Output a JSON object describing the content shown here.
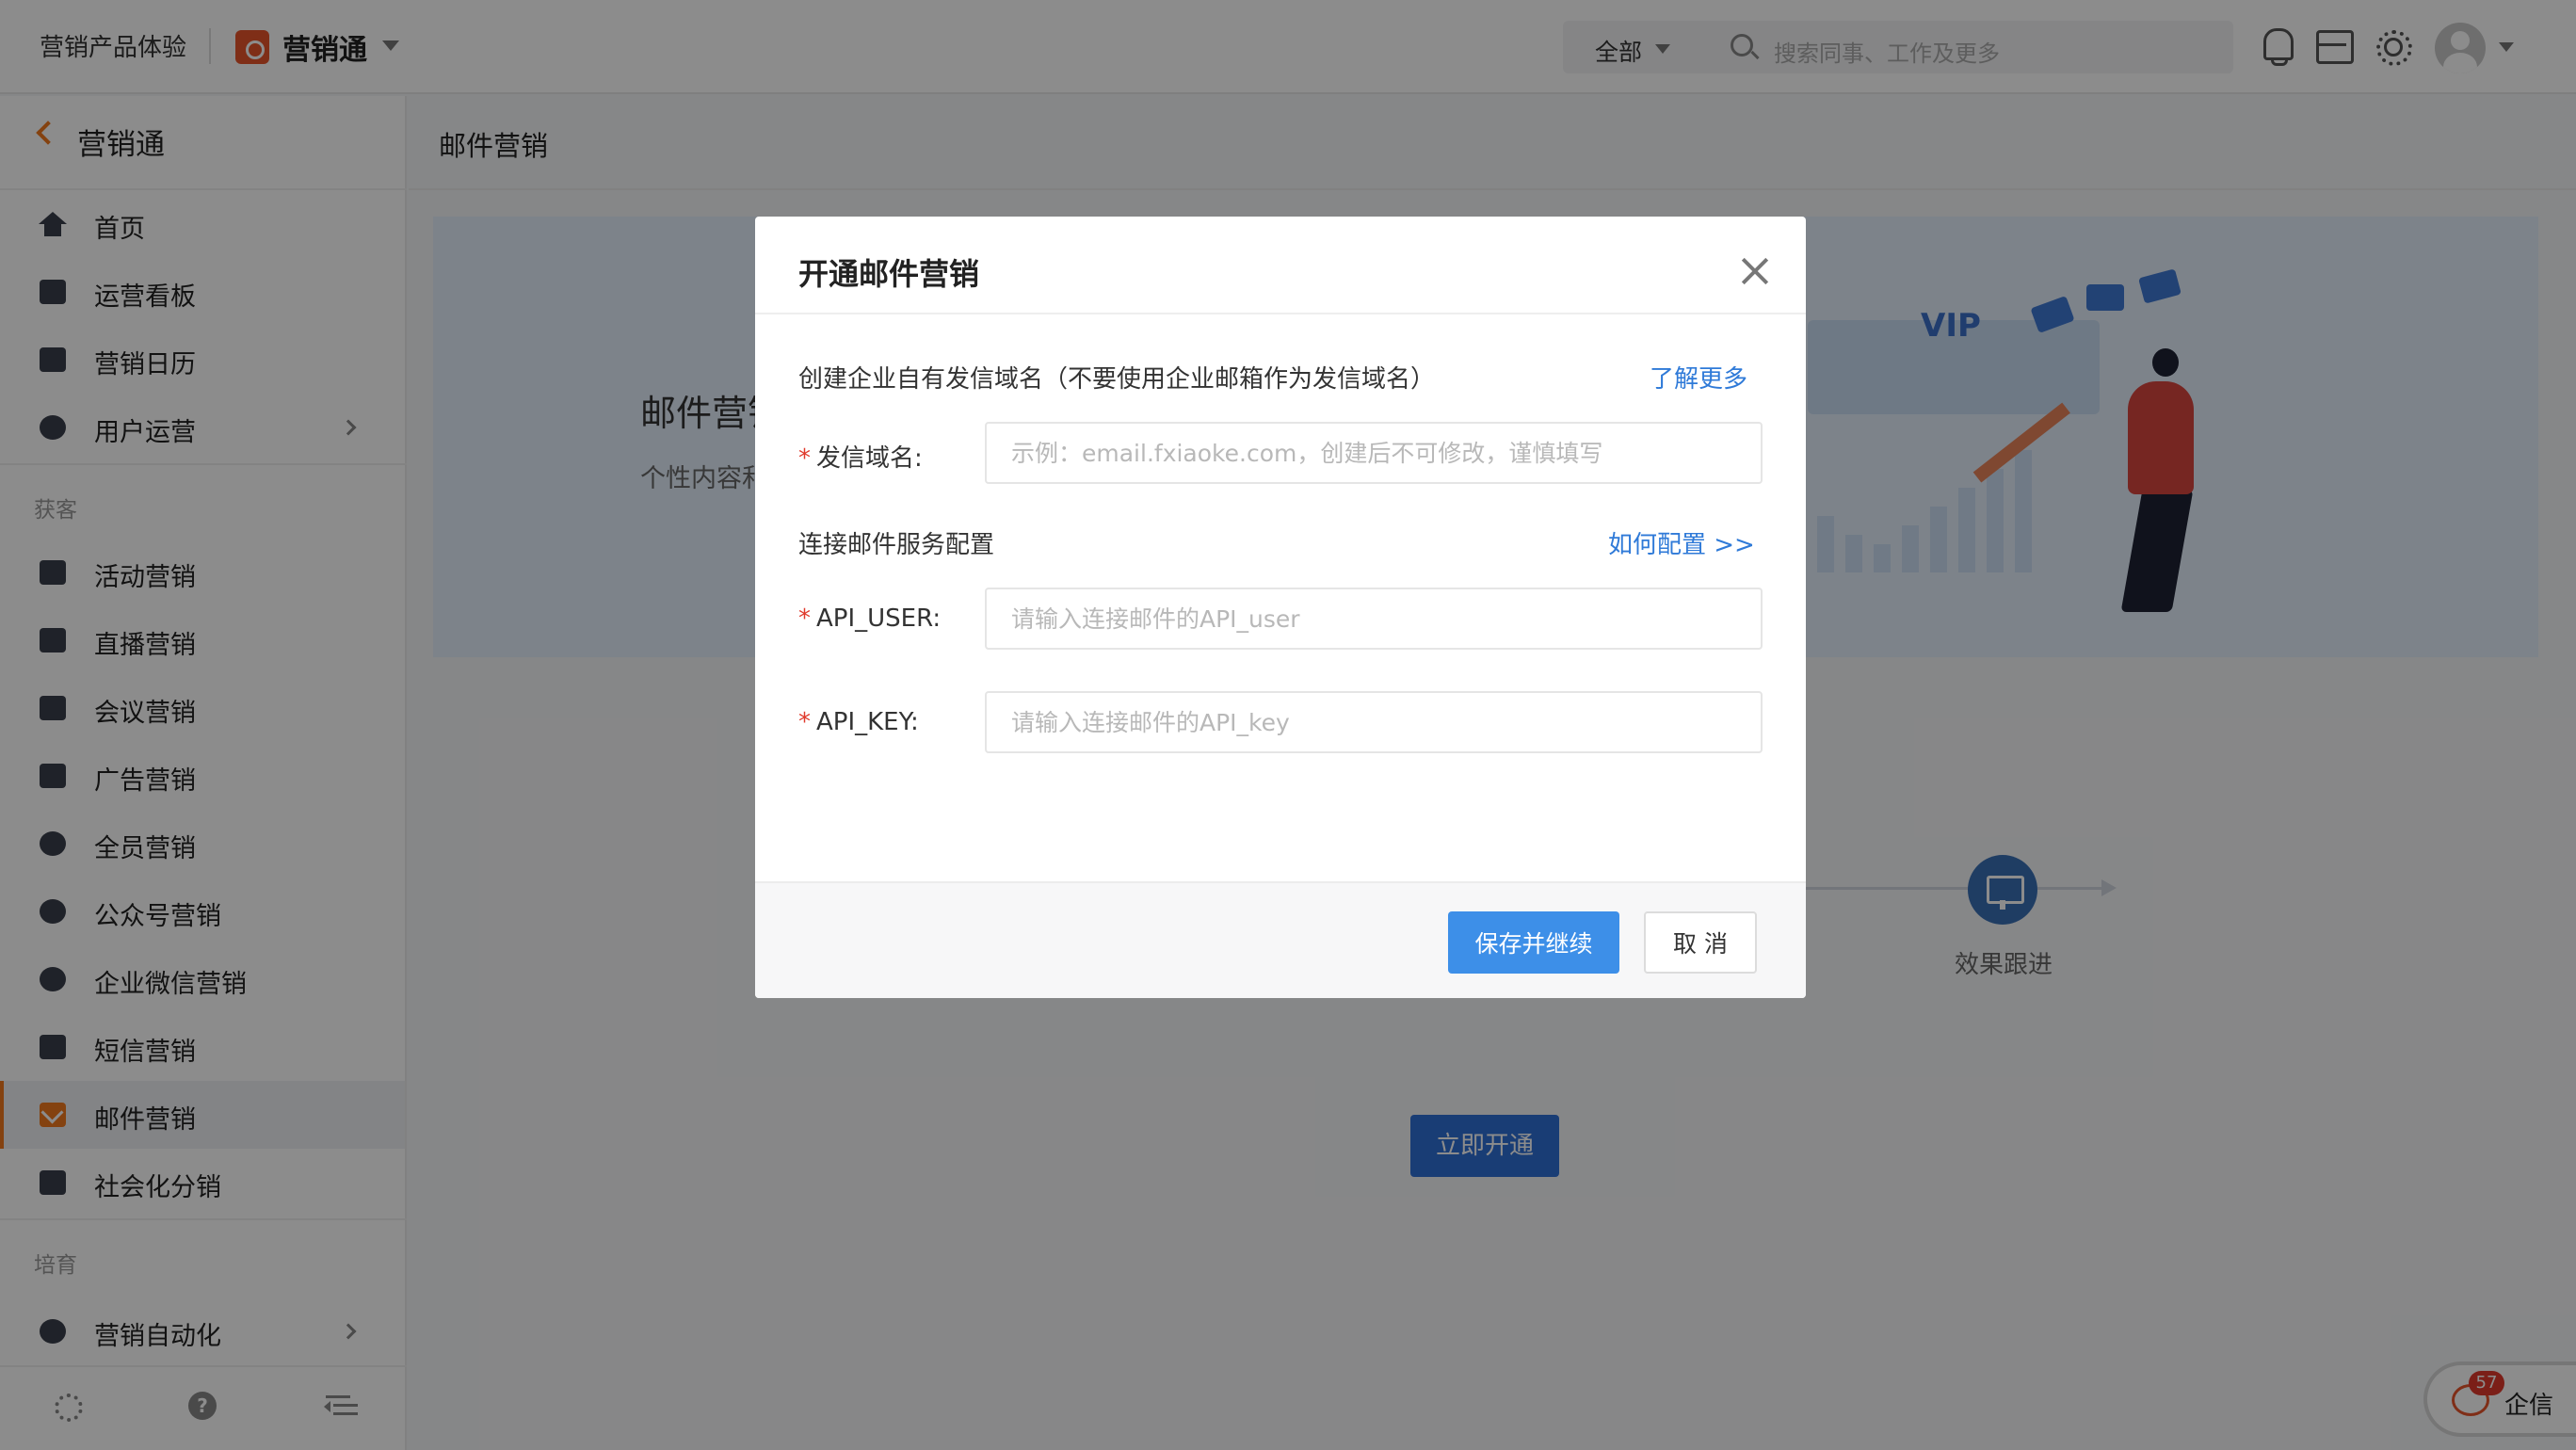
{
  "topbar": {
    "org_name": "营销产品体验",
    "app_name": "营销通",
    "scope_label": "全部",
    "search_placeholder": "搜索同事、工作及更多"
  },
  "sidebar": {
    "title": "营销通",
    "items": [
      {
        "label": "首页"
      },
      {
        "label": "运营看板"
      },
      {
        "label": "营销日历"
      },
      {
        "label": "用户运营"
      },
      {
        "label": "活动营销"
      },
      {
        "label": "直播营销"
      },
      {
        "label": "会议营销"
      },
      {
        "label": "广告营销"
      },
      {
        "label": "全员营销"
      },
      {
        "label": "公众号营销"
      },
      {
        "label": "企业微信营销"
      },
      {
        "label": "短信营销"
      },
      {
        "label": "邮件营销"
      },
      {
        "label": "社会化分销"
      },
      {
        "label": "营销自动化"
      }
    ],
    "sections": {
      "acquire": "获客",
      "nurture": "培育"
    },
    "active_item": "邮件营销"
  },
  "main": {
    "page_title": "邮件营销",
    "banner_title": "邮件营销",
    "banner_subtitle": "个性内容和",
    "banner_vip": "VIP",
    "step_label": "效果跟进",
    "open_button": "立即开通"
  },
  "chat": {
    "badge": "57",
    "label": "企信"
  },
  "modal": {
    "title": "开通邮件营销",
    "section1": "创建企业自有发信域名（不要使用企业邮箱作为发信域名）",
    "learn_more": "了解更多",
    "domain_label": "发信域名:",
    "domain_placeholder": "示例：email.fxiaoke.com，创建后不可修改，谨慎填写",
    "section2": "连接邮件服务配置",
    "how_to_config": "如何配置 >>",
    "api_user_label": "API_USER:",
    "api_user_placeholder": "请输入连接邮件的API_user",
    "api_key_label": "API_KEY:",
    "api_key_placeholder": "请输入连接邮件的API_key",
    "save_button": "保存并继续",
    "cancel_button": "取 消",
    "required_mark": "*"
  },
  "colors": {
    "accent_orange": "#f0781e",
    "primary_blue": "#3d8fe8",
    "link_blue": "#2f7ad8"
  }
}
